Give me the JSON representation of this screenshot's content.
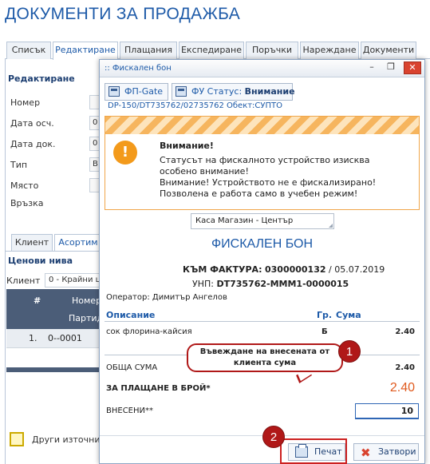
{
  "app": {
    "title": "ДОКУМЕНТИ ЗА ПРОДАЖБА",
    "tabs": [
      "Списък",
      "Редактиране",
      "Плащания",
      "Експедиране",
      "Поръчки",
      "Нареждане",
      "Документи"
    ]
  },
  "editor": {
    "section": "Редактиране",
    "fields": [
      {
        "label": "Номер",
        "value": ""
      },
      {
        "label": "Дата осч.",
        "value": "0"
      },
      {
        "label": "Дата док.",
        "value": "0"
      },
      {
        "label": "Тип",
        "value": "В"
      },
      {
        "label": "Място",
        "value": ""
      },
      {
        "label": "Връзка",
        "value": ""
      }
    ],
    "subtabs": [
      "Клиент",
      "Асортим"
    ],
    "price_levels_title": "Ценови нива",
    "client_label": "Клиент",
    "client_value": "0 - Крайни ц",
    "grid": {
      "col_num": "#",
      "col_number": "Номер",
      "col_batch": "Партид",
      "row_index": "1.",
      "row_value": "0--0001"
    },
    "other_sources_label": "Други източници"
  },
  "modal": {
    "title": ":: Фискален бон",
    "fp_gate_label": "ФП-Gate",
    "fu_status_label": "ФУ Статус:",
    "fu_status_value": "Внимание",
    "device_line": "DP-150/DT735762/02735762 Обект:СУПТО",
    "warning": {
      "icon": "!",
      "title": "Внимание!",
      "lines": [
        "Статусът на фискалното устройство изисква",
        "особено внимание!",
        "Внимание! Устройството не е фискализирано!",
        "Позволена е работа само в учебен режим!"
      ]
    },
    "store": "Каса Магазин - Център",
    "receipt_title": "ФИСКАЛЕН БОН",
    "invoice_label": "КЪМ ФАКТУРА:",
    "invoice_number": "0300000132",
    "invoice_date": "/ 05.07.2019",
    "unp_label": "УНП:",
    "unp_value": "DT735762-MMM1-0000015",
    "operator": "Оператор: Димитър Ангелов",
    "table": {
      "col_description": "Описание",
      "col_group": "Гр.",
      "col_amount": "Сума",
      "items": [
        {
          "description": "сок флорина-кайсия",
          "group": "Б",
          "amount": "2.40"
        }
      ]
    },
    "total_label": "ОБЩА СУМА",
    "total_value": "2.40",
    "cash_label": "ЗА ПЛАЩАНЕ В БРОЙ*",
    "cash_value": "2.40",
    "paid_label": "ВНЕСЕНИ**",
    "paid_value": "10",
    "print_label": "Печат",
    "close_label": "Затвори"
  },
  "annotations": {
    "callout_line1": "Въвеждане на внесената от",
    "callout_line2": "клиента сума",
    "badge1": "1",
    "badge2": "2"
  }
}
